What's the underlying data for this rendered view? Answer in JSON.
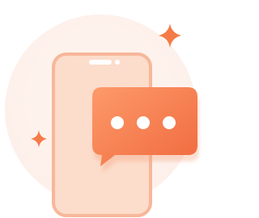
{
  "illustration": {
    "subject": "phone-with-chat-bubble",
    "icons": {
      "phone": "smartphone-icon",
      "bubble": "chat-bubble-icon",
      "dots": "typing-dots-icon",
      "sparkle": "sparkle-icon"
    },
    "colors": {
      "background_circle": "#fdf0ea",
      "phone_body": "#fcdccb",
      "phone_outline": "#f7b79a",
      "phone_speaker": "#ffffff",
      "bubble_start": "#fd9a6a",
      "bubble_end": "#f06a3e",
      "dots": "#ffffff",
      "sparkle": "#f47b47"
    }
  }
}
